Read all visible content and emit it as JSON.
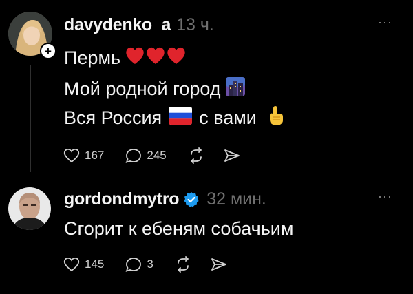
{
  "posts": [
    {
      "username": "davydenko_a",
      "time": "13 ч.",
      "more_label": "···",
      "lines": [
        "Пермь",
        "Мой родной город",
        "Вся Россия",
        "с вами"
      ],
      "emojis": [
        "heart",
        "heart",
        "heart",
        "night-city",
        "russia-flag",
        "pointing-up"
      ],
      "likes": "167",
      "replies": "245"
    },
    {
      "username": "gordondmytro",
      "verified": true,
      "time": "32 мин.",
      "more_label": "···",
      "lines": [
        "Сгорит к ебеням собачьим"
      ],
      "likes": "145",
      "replies": "3"
    }
  ],
  "colors": {
    "background": "#000000",
    "text": "#f4f4f4",
    "muted": "#6f6f6f",
    "verified": "#1d9bf0",
    "heart": "#e0242c"
  }
}
